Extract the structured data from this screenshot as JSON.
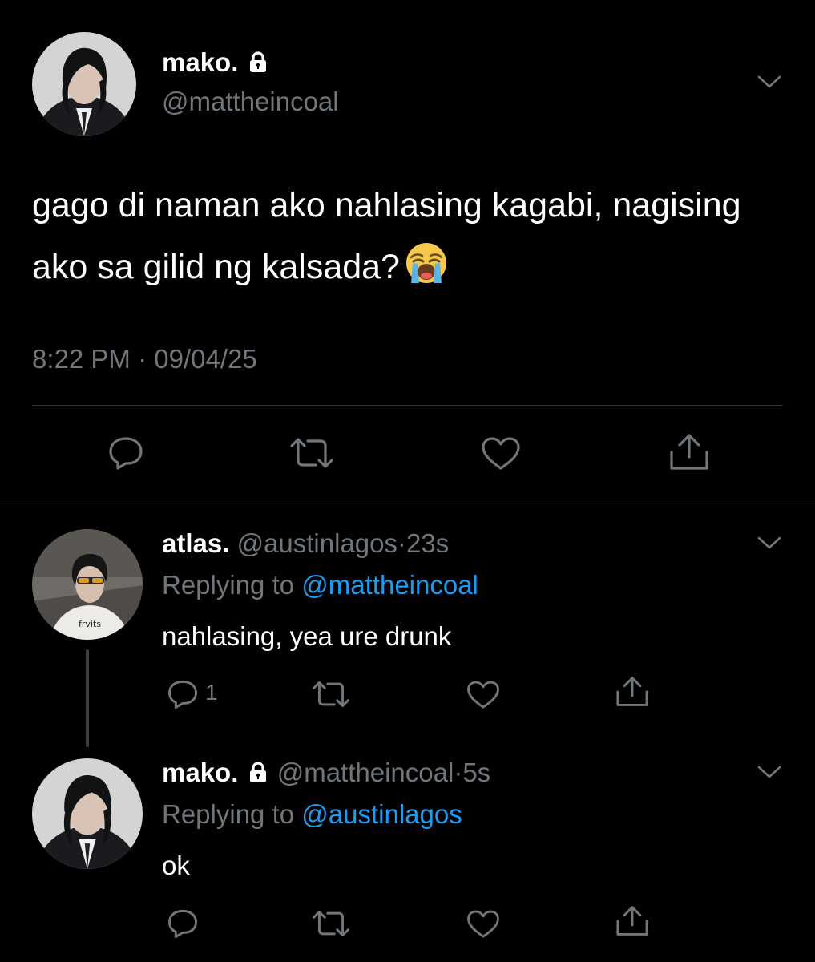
{
  "main_tweet": {
    "display_name": "mako.",
    "handle": "@mattheincoal",
    "text": "gago di naman ako nahlasing kagabi, nagising ako sa gilid ng kalsada?",
    "emoji_icon": "loudly-crying-face-icon",
    "time": "8:22 PM",
    "separator": "·",
    "date": "09/04/25"
  },
  "replies": [
    {
      "display_name": "atlas.",
      "handle": "@austinlagos",
      "separator": "·",
      "age": "23s",
      "replying_prefix": "Replying to",
      "replying_to": "@mattheincoal",
      "text": "nahlasing, yea ure drunk",
      "reply_count": "1"
    },
    {
      "display_name": "mako.",
      "handle": "@mattheincoal",
      "separator": "·",
      "age": "5s",
      "replying_prefix": "Replying to",
      "replying_to": "@austinlagos",
      "text": "ok",
      "reply_count": ""
    }
  ],
  "icons": {
    "lock": "lock-icon",
    "chevron": "chevron-down-icon",
    "reply": "reply-icon",
    "retweet": "retweet-icon",
    "like": "heart-icon",
    "share": "share-icon"
  },
  "colors": {
    "background": "#000000",
    "primary_text": "#e7e9ea",
    "secondary_text": "#71767b",
    "accent": "#1d9bf0",
    "divider": "#2f3336"
  }
}
